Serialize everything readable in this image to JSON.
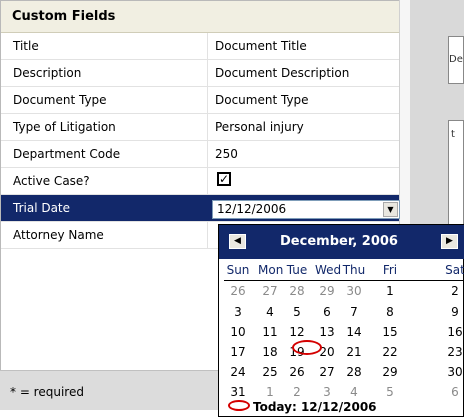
{
  "panel": {
    "title": "Custom Fields",
    "footer_note": "* = required"
  },
  "fields": [
    {
      "label": "Title",
      "value": "Document Title"
    },
    {
      "label": "Description",
      "value": "Document Description"
    },
    {
      "label": "Document Type",
      "value": "Document Type"
    },
    {
      "label": "Type of Litigation",
      "value": "Personal injury"
    },
    {
      "label": "Department Code",
      "value": "250"
    },
    {
      "label": "Active Case?",
      "value": "✓"
    },
    {
      "label": "Trial Date",
      "value": "12/12/2006"
    },
    {
      "label": "Attorney Name",
      "value": ""
    }
  ],
  "date_picker": {
    "month_label": "December, 2006",
    "prev_icon": "◀",
    "next_icon": "▶",
    "dropdown_icon": "▼",
    "weekdays": [
      "Sun",
      "Mon",
      "Tue",
      "Wed",
      "Thu",
      "Fri",
      "Sat"
    ],
    "weeks": [
      [
        "26",
        "27",
        "28",
        "29",
        "30",
        "1",
        "2"
      ],
      [
        "3",
        "4",
        "5",
        "6",
        "7",
        "8",
        "9"
      ],
      [
        "10",
        "11",
        "12",
        "13",
        "14",
        "15",
        "16"
      ],
      [
        "17",
        "18",
        "19",
        "20",
        "21",
        "22",
        "23"
      ],
      [
        "24",
        "25",
        "26",
        "27",
        "28",
        "29",
        "30"
      ],
      [
        "31",
        "1",
        "2",
        "3",
        "4",
        "5",
        "6"
      ]
    ],
    "selected_day": "12",
    "today_label": "Today: 12/12/2006"
  },
  "background_fragments": {
    "frag_a": "De",
    "frag_b": "t"
  },
  "colors": {
    "selection": "#12286a",
    "today_circle": "#d40000",
    "header_bg": "#f1efe2"
  }
}
